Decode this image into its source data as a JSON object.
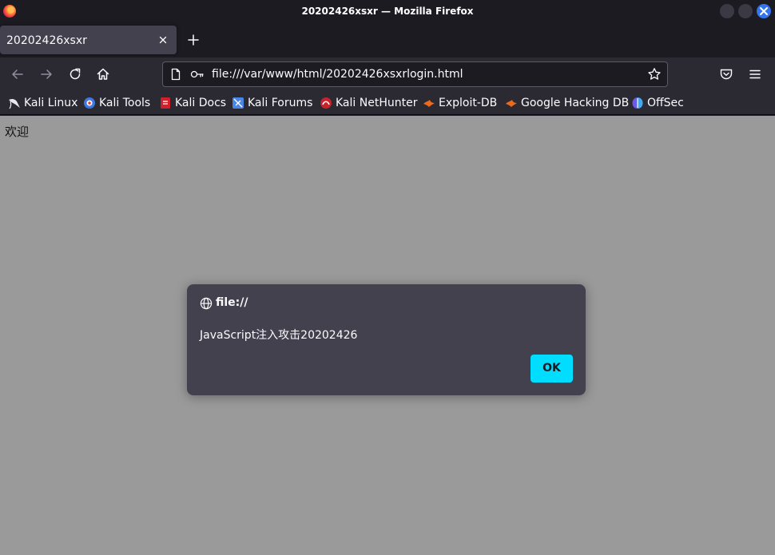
{
  "window": {
    "title": "20202426xsxr — Mozilla Firefox"
  },
  "tabs": [
    {
      "label": "20202426xsxr",
      "active": true
    }
  ],
  "urlbar": {
    "url": "file:///var/www/html/20202426xsxrlogin.html"
  },
  "bookmarks": [
    {
      "label": "Kali Linux",
      "icon": "kali-dragon-icon"
    },
    {
      "label": "Kali Tools",
      "icon": "kali-tools-icon"
    },
    {
      "label": "Kali Docs",
      "icon": "kali-docs-icon"
    },
    {
      "label": "Kali Forums",
      "icon": "kali-forums-icon"
    },
    {
      "label": "Kali NetHunter",
      "icon": "kali-nethunter-icon"
    },
    {
      "label": "Exploit-DB",
      "icon": "exploit-db-icon"
    },
    {
      "label": "Google Hacking DB",
      "icon": "ghdb-icon"
    },
    {
      "label": "OffSec",
      "icon": "offsec-icon"
    }
  ],
  "page": {
    "text": "欢迎"
  },
  "dialog": {
    "origin": "file://",
    "message": "JavaScript注入攻击20202426",
    "ok_label": "OK"
  },
  "colors": {
    "accent": "#00ddff",
    "content_background": "#9a9a9a",
    "dialog_background": "#42414d",
    "toolbar": "#2b2a33"
  }
}
